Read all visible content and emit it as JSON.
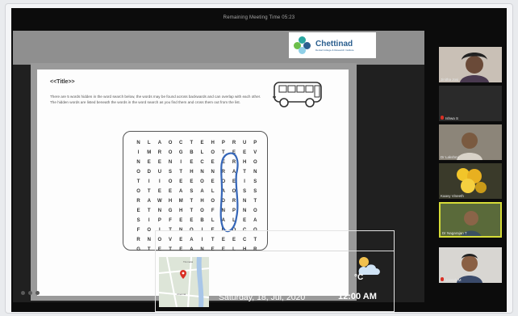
{
  "meeting": {
    "remaining_time_label": "Remaining Meeting Time 05:23"
  },
  "share": {
    "logo": {
      "name": "Chettinad",
      "subtitle": "Dental College & Research Institute"
    },
    "worksheet": {
      "title": "<<Title>>",
      "instructions": "There are 5 words hidden in the word search below, the words may be found across backwards and can overlap with each other. The hidden words are listed beneath the words in the word search as you find them and cross them out from the list.",
      "grid": [
        "NLAOCTEHPRUP",
        "IMROGBLOTEEV",
        "NEENIECEERHO",
        "ODUSTHNNRATN",
        "TIIOEEOEOEIS",
        "OTEEASALAOSS",
        "RAWHMTHODRNT",
        "ETNGHTOFNPNO",
        "SIPFEEBLALEA",
        "FOITNOIEDOCO",
        "RNOVEAITEECT",
        "GTETEANEELHR"
      ]
    }
  },
  "overlay": {
    "temperature": "°C",
    "date": "Saturday, 18, Jul, 2020",
    "time": "12:00 AM",
    "map_labels": [
      "Tirumalai",
      "Chennai"
    ]
  },
  "participants": [
    {
      "name": "Jinitha Josi",
      "muted": false,
      "active": false
    },
    {
      "name": "Ishwa S",
      "muted": true,
      "active": false
    },
    {
      "name": "Dr Lakshmi",
      "muted": false,
      "active": false
    },
    {
      "name": "Kaavy Vineeth",
      "muted": false,
      "active": false
    },
    {
      "name": "Dr Nagarajan T",
      "muted": false,
      "active": true
    },
    {
      "name": "Joseph M",
      "muted": true,
      "active": false
    }
  ],
  "colors": {
    "active_tile": "#d6dc38",
    "mic_muted": "#d93025",
    "circle_ink": "#3566b8",
    "logo_blue": "#2b5f8f"
  }
}
